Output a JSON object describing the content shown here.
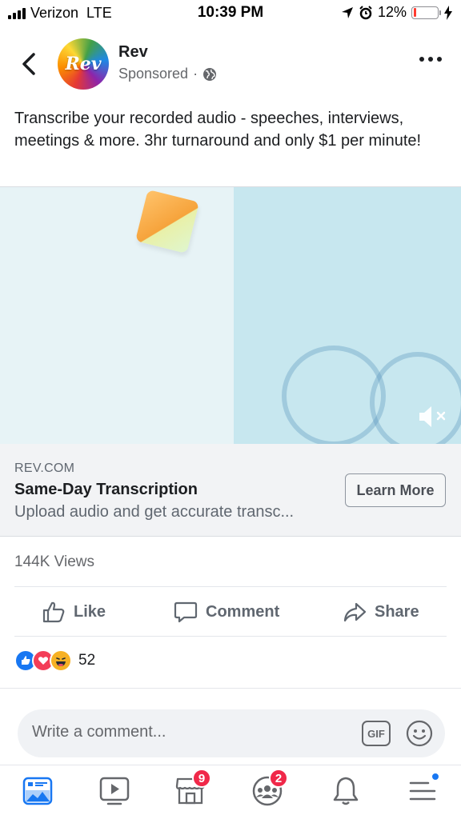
{
  "status_bar": {
    "carrier": "Verizon",
    "network": "LTE",
    "time": "10:39 PM",
    "battery_percent": "12%",
    "battery_level": 0.12
  },
  "post": {
    "page_name": "Rev",
    "avatar_text": "Rev",
    "sponsored_label": "Sponsored",
    "separator": "·",
    "text": "Transcribe your recorded audio - speeches, interviews, meetings & more. 3hr turnaround and only $1 per minute!"
  },
  "link_card": {
    "domain": "REV.COM",
    "title": "Same-Day Transcription",
    "description": "Upload audio and get accurate transc...",
    "cta_label": "Learn More"
  },
  "stats": {
    "views": "144K Views",
    "reaction_count": "52"
  },
  "actions": {
    "like": "Like",
    "comment": "Comment",
    "share": "Share"
  },
  "comment_box": {
    "placeholder": "Write a comment...",
    "gif_label": "GIF"
  },
  "bottom_nav": {
    "marketplace_badge": "9",
    "groups_badge": "2"
  },
  "colors": {
    "accent_blue": "#1877f2",
    "badge_red": "#f02849",
    "text_primary": "#1c1e21",
    "text_secondary": "#65676b"
  },
  "icons": [
    "chevron-left-icon",
    "globe-icon",
    "more-icon",
    "mute-icon",
    "like-icon",
    "comment-icon",
    "share-icon",
    "gif-icon",
    "emoji-icon",
    "news-feed-icon",
    "watch-icon",
    "marketplace-icon",
    "groups-icon",
    "notifications-icon",
    "menu-icon"
  ]
}
